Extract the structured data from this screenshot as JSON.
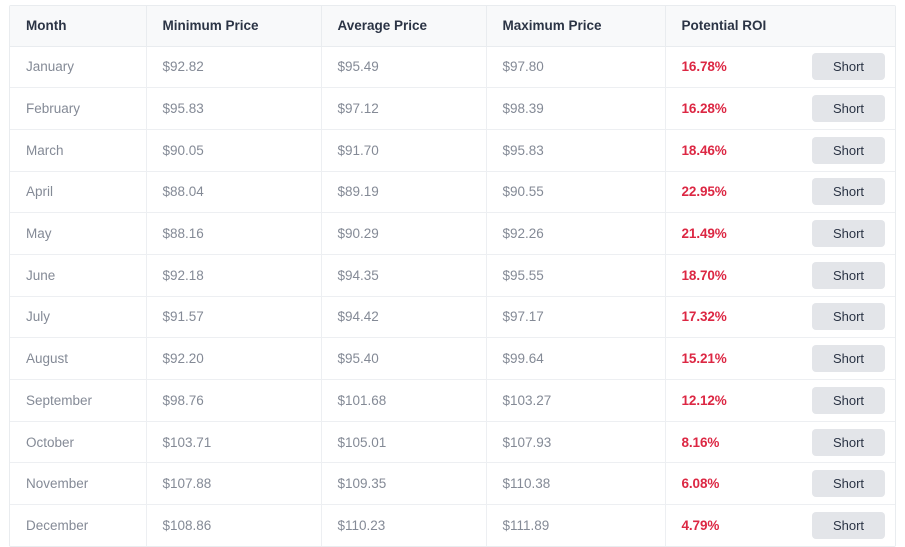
{
  "table": {
    "columns": [
      {
        "key": "month",
        "label": "Month"
      },
      {
        "key": "min",
        "label": "Minimum Price"
      },
      {
        "key": "avg",
        "label": "Average Price"
      },
      {
        "key": "max",
        "label": "Maximum Price"
      },
      {
        "key": "roi",
        "label": "Potential ROI"
      },
      {
        "key": "action",
        "label": ""
      }
    ],
    "action_label": "Short",
    "roi_color": "#dc2743",
    "header_bg": "#f8f9fa",
    "header_text_color": "#2b3445",
    "cell_text_color": "#848a96",
    "button_bg": "#e3e5e9",
    "button_text_color": "#2b3445",
    "border_color": "#e9ecef",
    "rows": [
      {
        "month": "January",
        "min": "$92.82",
        "avg": "$95.49",
        "max": "$97.80",
        "roi": "16.78%",
        "action": "Short"
      },
      {
        "month": "February",
        "min": "$95.83",
        "avg": "$97.12",
        "max": "$98.39",
        "roi": "16.28%",
        "action": "Short"
      },
      {
        "month": "March",
        "min": "$90.05",
        "avg": "$91.70",
        "max": "$95.83",
        "roi": "18.46%",
        "action": "Short"
      },
      {
        "month": "April",
        "min": "$88.04",
        "avg": "$89.19",
        "max": "$90.55",
        "roi": "22.95%",
        "action": "Short"
      },
      {
        "month": "May",
        "min": "$88.16",
        "avg": "$90.29",
        "max": "$92.26",
        "roi": "21.49%",
        "action": "Short"
      },
      {
        "month": "June",
        "min": "$92.18",
        "avg": "$94.35",
        "max": "$95.55",
        "roi": "18.70%",
        "action": "Short"
      },
      {
        "month": "July",
        "min": "$91.57",
        "avg": "$94.42",
        "max": "$97.17",
        "roi": "17.32%",
        "action": "Short"
      },
      {
        "month": "August",
        "min": "$92.20",
        "avg": "$95.40",
        "max": "$99.64",
        "roi": "15.21%",
        "action": "Short"
      },
      {
        "month": "September",
        "min": "$98.76",
        "avg": "$101.68",
        "max": "$103.27",
        "roi": "12.12%",
        "action": "Short"
      },
      {
        "month": "October",
        "min": "$103.71",
        "avg": "$105.01",
        "max": "$107.93",
        "roi": "8.16%",
        "action": "Short"
      },
      {
        "month": "November",
        "min": "$107.88",
        "avg": "$109.35",
        "max": "$110.38",
        "roi": "6.08%",
        "action": "Short"
      },
      {
        "month": "December",
        "min": "$108.86",
        "avg": "$110.23",
        "max": "$111.89",
        "roi": "4.79%",
        "action": "Short"
      }
    ]
  }
}
